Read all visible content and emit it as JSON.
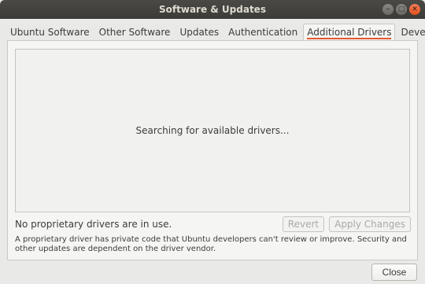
{
  "window": {
    "title": "Software & Updates"
  },
  "tabs": [
    {
      "label": "Ubuntu Software",
      "active": false
    },
    {
      "label": "Other Software",
      "active": false
    },
    {
      "label": "Updates",
      "active": false
    },
    {
      "label": "Authentication",
      "active": false
    },
    {
      "label": "Additional Drivers",
      "active": true
    },
    {
      "label": "Developer Options",
      "active": false
    }
  ],
  "drivers": {
    "searching_text": "Searching for available drivers...",
    "status_text": "No proprietary drivers are in use.",
    "revert_label": "Revert",
    "apply_label": "Apply Changes",
    "info_text": "A proprietary driver has private code that Ubuntu developers can't review or improve. Security and other updates are dependent on the driver vendor."
  },
  "footer": {
    "close_label": "Close"
  },
  "colors": {
    "title_bar": "#3c3b37",
    "accent": "#e35a2f",
    "close_window_button": "#e2501c"
  },
  "icons": {
    "minimize": "minimize-icon",
    "maximize": "maximize-icon",
    "close": "close-icon"
  }
}
